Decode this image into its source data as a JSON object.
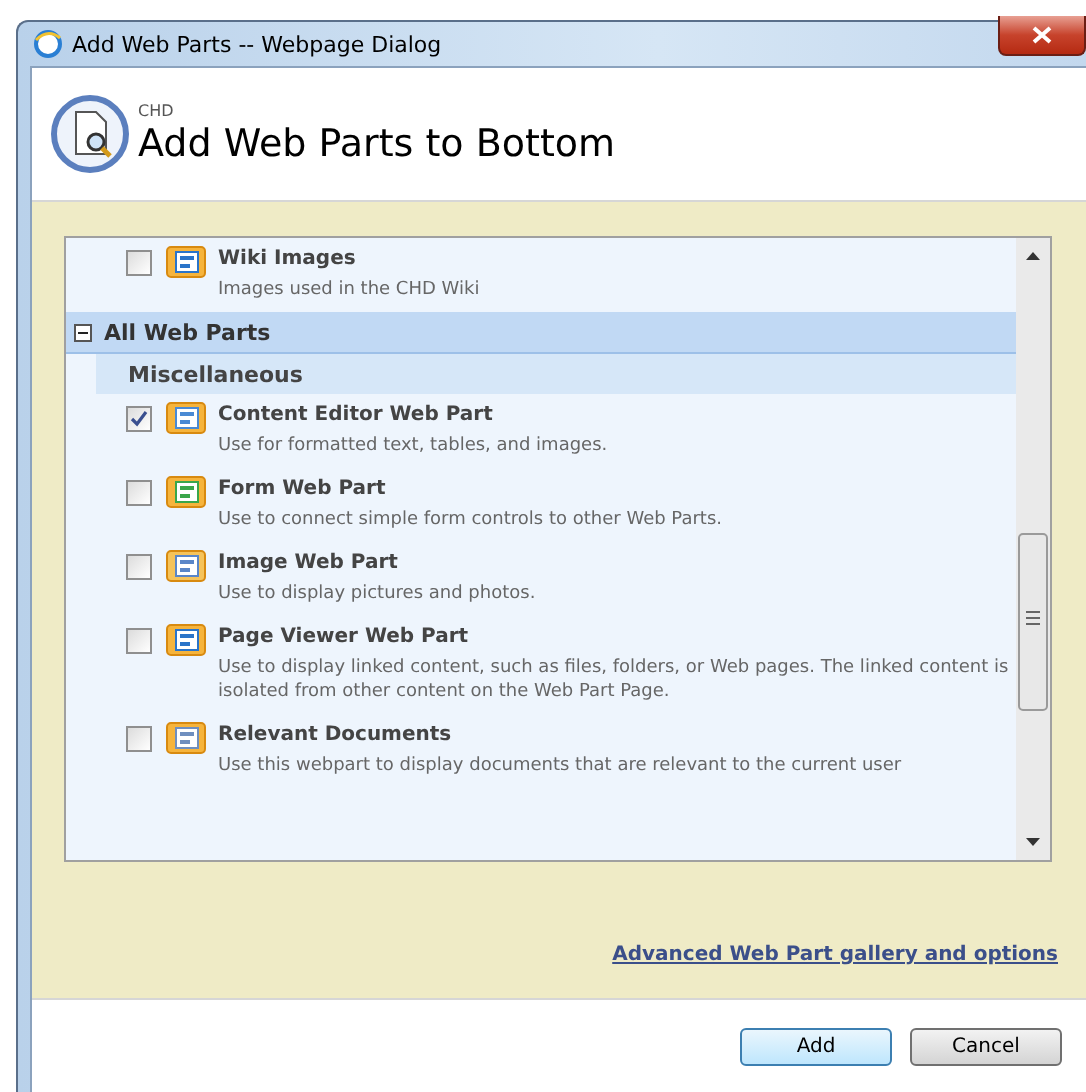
{
  "window": {
    "title": "Add Web Parts -- Webpage Dialog"
  },
  "header": {
    "site": "CHD",
    "title": "Add Web Parts to Bottom"
  },
  "list": [
    {
      "kind": "item",
      "title": "Wiki Images",
      "description": "Images used in the CHD Wiki",
      "checked": false
    },
    {
      "kind": "group",
      "title": "All Web Parts",
      "expanded": true
    },
    {
      "kind": "category",
      "title": "Miscellaneous"
    },
    {
      "kind": "item",
      "title": "Content Editor Web Part",
      "description": "Use for formatted text, tables, and images.",
      "checked": true
    },
    {
      "kind": "item",
      "title": "Form Web Part",
      "description": "Use to connect simple form controls to other Web Parts.",
      "checked": false
    },
    {
      "kind": "item",
      "title": "Image Web Part",
      "description": "Use to display pictures and photos.",
      "checked": false
    },
    {
      "kind": "item",
      "title": "Page Viewer Web Part",
      "description": "Use to display linked content, such as files, folders, or Web pages. The linked content is isolated from other content on the Web Part Page.",
      "checked": false
    },
    {
      "kind": "item",
      "title": "Relevant Documents",
      "description": "Use this webpart to display documents that are relevant to the current user",
      "checked": false
    }
  ],
  "advanced_link": "Advanced Web Part gallery and options",
  "buttons": [
    {
      "label": "Add",
      "default": true
    },
    {
      "label": "Cancel",
      "default": false
    }
  ]
}
